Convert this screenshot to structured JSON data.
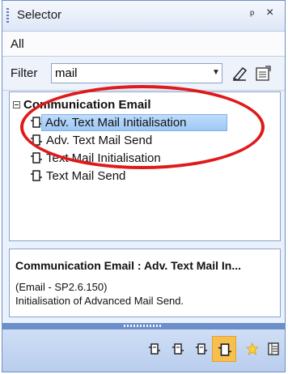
{
  "window": {
    "title": "Selector",
    "pin_glyph": "ᵖ",
    "close_glyph": "×"
  },
  "all_bar": {
    "label": "All"
  },
  "filter": {
    "label": "Filter",
    "value": "mail"
  },
  "tree": {
    "group": {
      "label": "Communication Email",
      "expanded": true
    },
    "items": [
      {
        "label": "Adv. Text Mail Initialisation",
        "selected": true
      },
      {
        "label": "Adv. Text Mail Send",
        "selected": false
      },
      {
        "label": "Text Mail Initialisation",
        "selected": false
      },
      {
        "label": "Text Mail Send",
        "selected": false
      }
    ]
  },
  "details": {
    "title": "Communication Email : Adv. Text Mail In...",
    "line1": "(Email - SP2.6.150)",
    "line2": "Initialisation of Advanced Mail Send."
  },
  "toolbar": {
    "buttons": [
      {
        "icon": "function-block-icon"
      },
      {
        "icon": "function-block-icon"
      },
      {
        "icon": "function-block-icon"
      },
      {
        "icon": "function-block-active-icon",
        "active": true
      },
      {
        "icon": "favorites-star-icon"
      },
      {
        "icon": "list-view-icon"
      }
    ]
  },
  "colors": {
    "accent": "#6c8ec9",
    "annotation": "#e0191a",
    "selection": "#9fc7f5"
  }
}
